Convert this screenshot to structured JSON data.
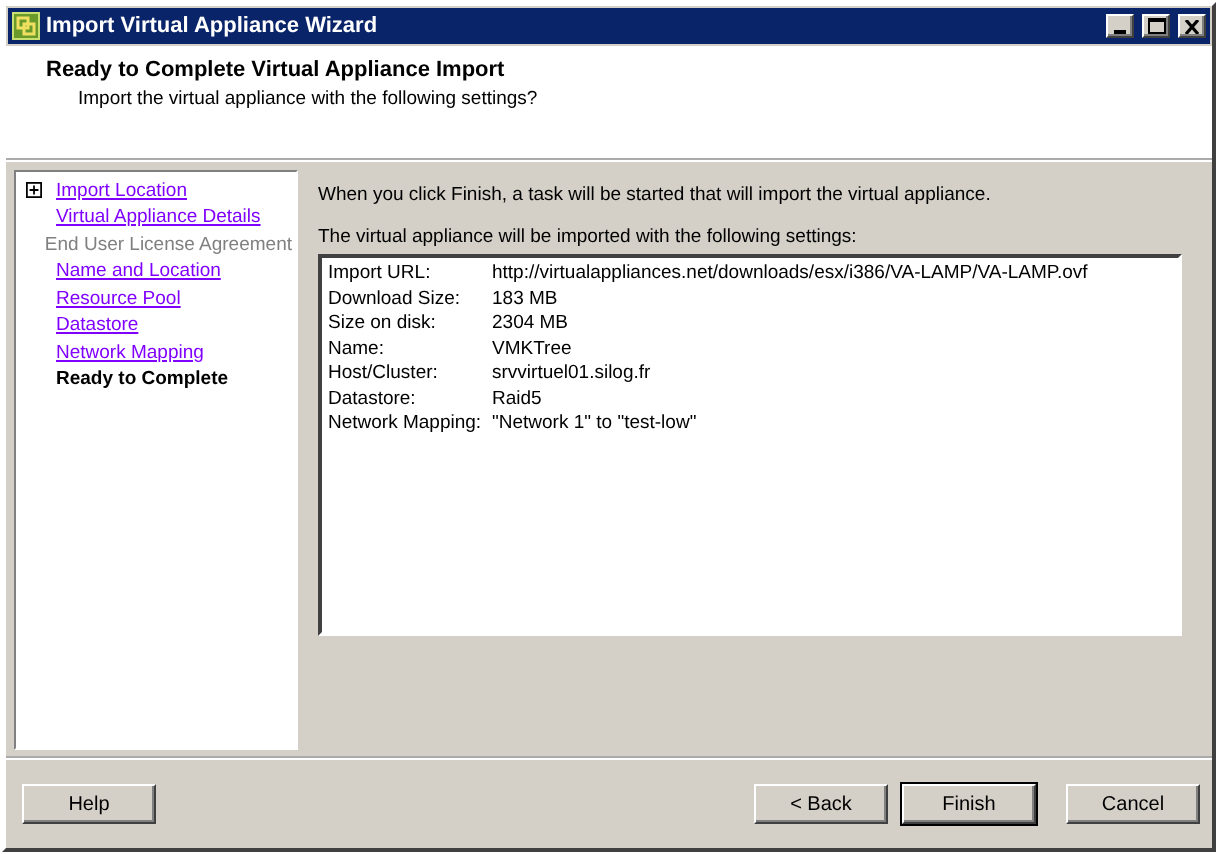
{
  "window": {
    "title": "Import Virtual Appliance Wizard"
  },
  "header": {
    "title": "Ready to Complete Virtual Appliance Import",
    "subtitle": "Import the virtual appliance with the following settings?"
  },
  "steps": [
    {
      "label": "Import Location",
      "kind": "link",
      "expandable": true
    },
    {
      "label": "Virtual Appliance Details",
      "kind": "link",
      "expandable": false
    },
    {
      "label": "End User License Agreement",
      "kind": "disabled",
      "expandable": false
    },
    {
      "label": "Name and Location",
      "kind": "link",
      "expandable": false
    },
    {
      "label": "Resource Pool",
      "kind": "link",
      "expandable": false
    },
    {
      "label": "Datastore",
      "kind": "link",
      "expandable": false
    },
    {
      "label": "Network Mapping",
      "kind": "link",
      "expandable": false
    },
    {
      "label": "Ready to Complete",
      "kind": "current",
      "expandable": false
    }
  ],
  "intro": "When you click Finish, a task will be started that will import the virtual appliance.",
  "settings_caption": "The virtual appliance will be imported with the following settings:",
  "settings": [
    {
      "label": "Import URL:",
      "value": "http://virtualappliances.net/downloads/esx/i386/VA-LAMP/VA-LAMP.ovf"
    },
    {
      "label": "Download Size:",
      "value": "183 MB"
    },
    {
      "label": "Size on disk:",
      "value": "2304 MB"
    },
    {
      "label": "Name:",
      "value": "VMKTree"
    },
    {
      "label": "Host/Cluster:",
      "value": "srvvirtuel01.silog.fr"
    },
    {
      "label": "Datastore:",
      "value": "Raid5"
    },
    {
      "label": "Network Mapping:",
      "value": "\"Network 1\" to \"test-low\""
    }
  ],
  "help_button": "Help",
  "buttons": [
    {
      "label": "< Back",
      "default": false
    },
    {
      "label": "Finish",
      "default": true
    },
    {
      "label": "Cancel",
      "default": false
    }
  ]
}
